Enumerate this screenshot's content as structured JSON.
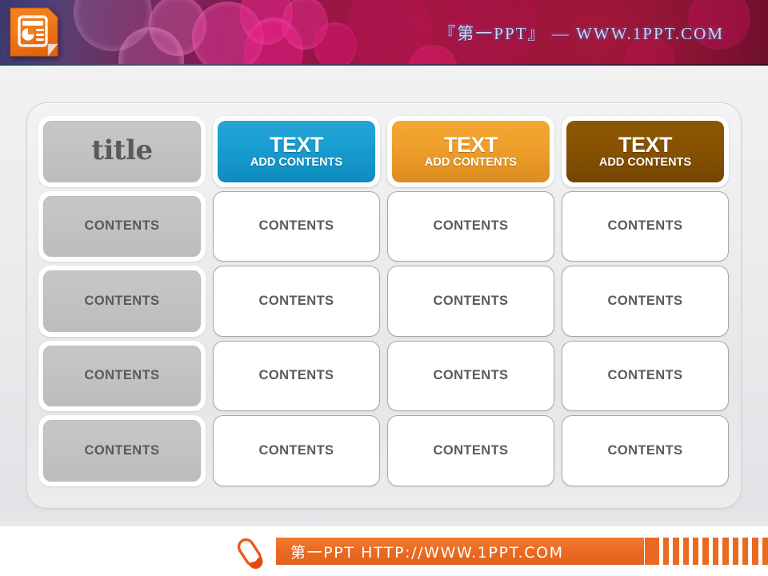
{
  "header": {
    "logo_icon": "powerpoint-logo-icon",
    "title": "『第一PPT』 — WWW.1PPT.COM"
  },
  "table": {
    "columns": [
      {
        "key": "col-title",
        "header_style": "gray",
        "header_main": "title",
        "header_sub": ""
      },
      {
        "key": "col-blue",
        "header_style": "blue",
        "header_main": "TEXT",
        "header_sub": "ADD CONTENTS"
      },
      {
        "key": "col-orange",
        "header_style": "orange",
        "header_main": "TEXT",
        "header_sub": "ADD CONTENTS"
      },
      {
        "key": "col-brown",
        "header_style": "brown",
        "header_main": "TEXT",
        "header_sub": "ADD CONTENTS"
      }
    ],
    "rows": [
      {
        "cells": [
          "CONTENTS",
          "CONTENTS",
          "CONTENTS",
          "CONTENTS"
        ]
      },
      {
        "cells": [
          "CONTENTS",
          "CONTENTS",
          "CONTENTS",
          "CONTENTS"
        ]
      },
      {
        "cells": [
          "CONTENTS",
          "CONTENTS",
          "CONTENTS",
          "CONTENTS"
        ]
      },
      {
        "cells": [
          "CONTENTS",
          "CONTENTS",
          "CONTENTS",
          "CONTENTS"
        ]
      }
    ],
    "row_count": 4,
    "column_count": 4
  },
  "footer": {
    "pen_icon": "pen-icon",
    "text": "第一PPT HTTP://WWW.1PPT.COM",
    "stripe_count": 12
  },
  "colors": {
    "blue": "#199fd2",
    "orange": "#ef9f2b",
    "brown": "#875301",
    "gray_cell": "#c2c2c2",
    "footer_orange": "#ea6a22",
    "header_magenta": "#8b1445",
    "text_gray": "#5b5b5b"
  }
}
